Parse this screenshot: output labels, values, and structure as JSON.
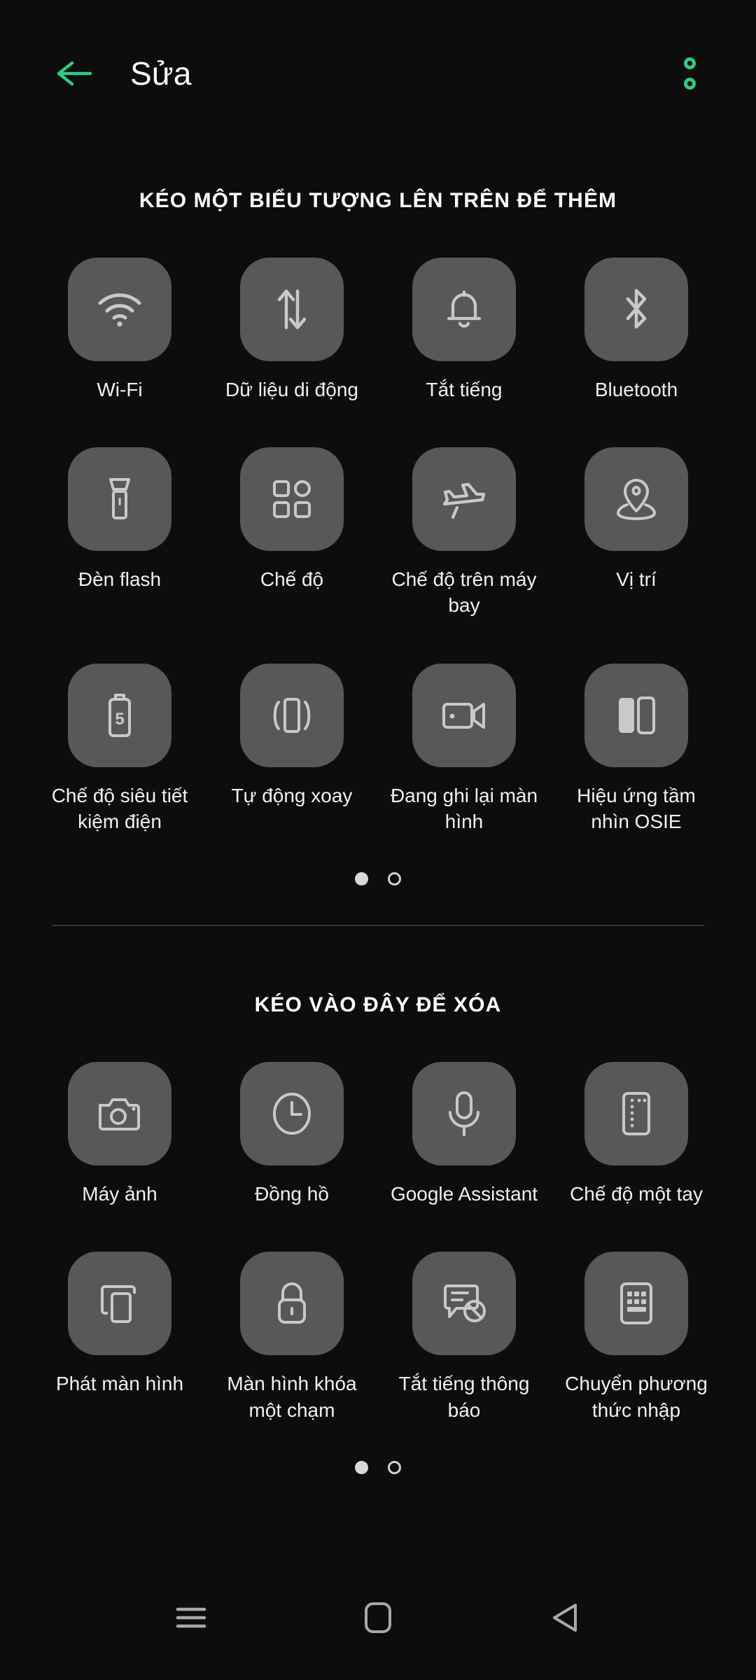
{
  "appbar": {
    "title": "Sửa",
    "back_icon": "arrow-left-icon",
    "back_color": "#2ecc80",
    "overflow_icon": "overflow-menu-icon",
    "overflow_color": "#2ecc80"
  },
  "colors": {
    "background": "#0d0d0d",
    "tile_background": "#585858",
    "icon": "#c9c9c9",
    "text": "#f0f0f0",
    "accent": "#2ecc80",
    "divider": "#343434"
  },
  "sections": [
    {
      "name": "add-section",
      "title": "KÉO MỘT BIỂU TƯỢNG LÊN TRÊN ĐỂ THÊM",
      "tiles": [
        {
          "label": "Wi-Fi",
          "icon": "wifi-icon"
        },
        {
          "label": "Dữ liệu di động",
          "icon": "mobile-data-icon"
        },
        {
          "label": "Tắt tiếng",
          "icon": "bell-mute-icon"
        },
        {
          "label": "Bluetooth",
          "icon": "bluetooth-icon"
        },
        {
          "label": "Đèn flash",
          "icon": "flashlight-icon"
        },
        {
          "label": "Chế độ",
          "icon": "modes-grid-icon"
        },
        {
          "label": "Chế độ trên máy bay",
          "icon": "airplane-icon"
        },
        {
          "label": "Vị trí",
          "icon": "location-pin-icon"
        },
        {
          "label": "Chế độ siêu tiết kiệm điện",
          "icon": "battery-saver-icon"
        },
        {
          "label": "Tự động xoay",
          "icon": "auto-rotate-icon"
        },
        {
          "label": "Đang ghi lại màn hình",
          "icon": "screen-record-icon"
        },
        {
          "label": "Hiệu ứng tầm nhìn OSIE",
          "icon": "osie-vision-icon"
        }
      ],
      "pager": {
        "total": 2,
        "active": 1
      }
    },
    {
      "name": "remove-section",
      "title": "KÉO VÀO ĐÂY ĐỂ XÓA",
      "tiles": [
        {
          "label": "Máy ảnh",
          "icon": "camera-icon"
        },
        {
          "label": "Đồng hồ",
          "icon": "clock-icon"
        },
        {
          "label": "Google Assistant",
          "icon": "microphone-icon"
        },
        {
          "label": "Chế độ một tay",
          "icon": "one-handed-mode-icon"
        },
        {
          "label": "Phát màn hình",
          "icon": "screen-cast-icon"
        },
        {
          "label": "Màn hình khóa một chạm",
          "icon": "lock-icon"
        },
        {
          "label": "Tắt tiếng thông báo",
          "icon": "notification-mute-icon"
        },
        {
          "label": "Chuyển phương thức nhập",
          "icon": "keyboard-switch-icon"
        }
      ],
      "pager": {
        "total": 2,
        "active": 1
      }
    }
  ],
  "navbar": {
    "recents_icon": "recents-menu-icon",
    "home_icon": "home-square-icon",
    "back_icon": "back-triangle-icon"
  }
}
